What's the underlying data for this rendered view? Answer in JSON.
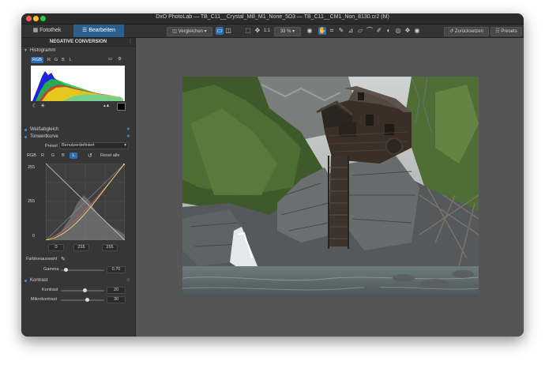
{
  "window": {
    "title": "DxO PhotoLab — TB_C11__Crystal_Mill_M1_None_5D3 — TB_C11__CM1_Non_8130.cr2 (M)"
  },
  "tabs": {
    "library": "Fotothek",
    "edit": "Bearbeiten"
  },
  "toolbar": {
    "compare": "Vergleichen",
    "ratio": "1:1",
    "zoom": "33 %",
    "reset": "Zurücksetzen",
    "presets": "Presets"
  },
  "panel": {
    "title": "NEGATIVE CONVERSION",
    "histogram": {
      "label": "Histogramm",
      "channels": [
        "RGB",
        "R",
        "G",
        "B",
        "L"
      ],
      "active": "RGB"
    },
    "white_balance": {
      "label": "Weißabgleich"
    },
    "tone_curve": {
      "label": "Tonwertkurve",
      "preset_label": "Preset",
      "preset_value": "Benutzerdefiniert",
      "channels": [
        "RGB",
        "R",
        "G",
        "B",
        "L"
      ],
      "active": "L",
      "reset_label": "Reset alle",
      "y_ticks": [
        "255",
        "255",
        "0"
      ],
      "in_fields": [
        "0",
        "255",
        "255"
      ],
      "picker_label": "Farbtonauswahl",
      "gamma_label": "Gamma",
      "gamma_value": "0.70",
      "gamma_position": 0.12
    },
    "contrast": {
      "label": "Kontrast",
      "contrast_label": "Kontrast",
      "contrast_value": "20",
      "contrast_position": 0.55,
      "micro_label": "Mikrokontrast",
      "micro_value": "30",
      "micro_position": 0.6
    }
  },
  "colors": {
    "accent": "#2d6fb0",
    "panel": "#363636",
    "viewer": "#555555"
  }
}
